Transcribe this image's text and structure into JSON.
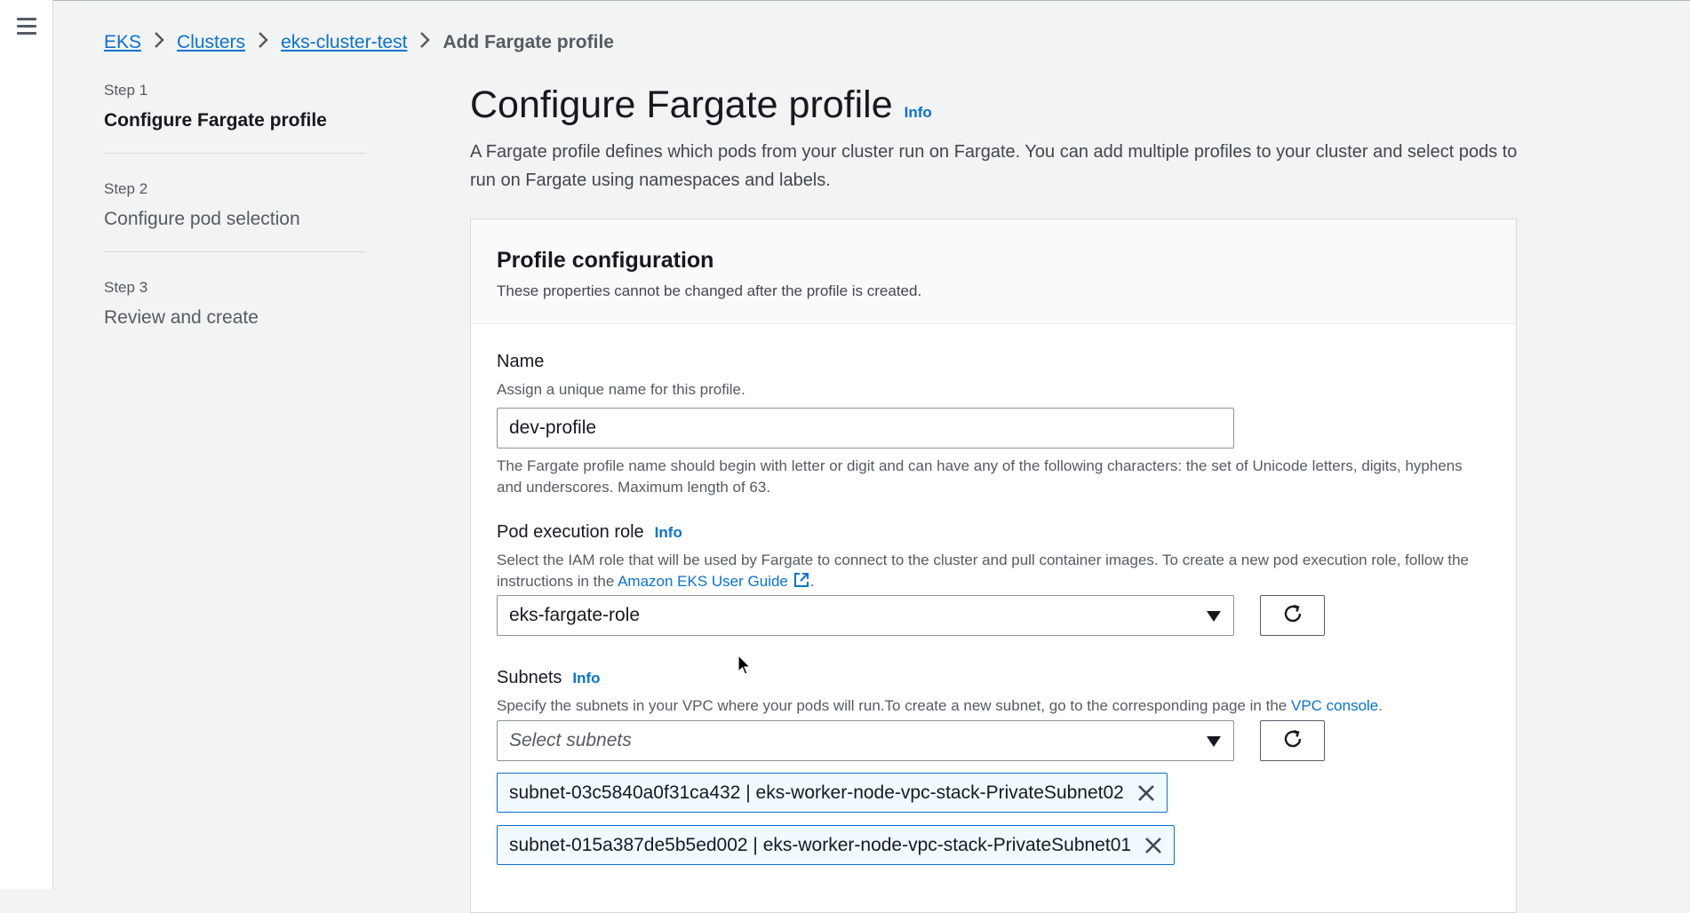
{
  "breadcrumb": {
    "items": [
      "EKS",
      "Clusters",
      "eks-cluster-test"
    ],
    "current": "Add Fargate profile"
  },
  "steps": [
    {
      "num": "Step 1",
      "title": "Configure Fargate profile",
      "active": true
    },
    {
      "num": "Step 2",
      "title": "Configure pod selection",
      "active": false
    },
    {
      "num": "Step 3",
      "title": "Review and create",
      "active": false
    }
  ],
  "page": {
    "title": "Configure Fargate profile",
    "info": "Info",
    "description": "A Fargate profile defines which pods from your cluster run on Fargate. You can add multiple profiles to your cluster and select pods to run on Fargate using namespaces and labels."
  },
  "card": {
    "title": "Profile configuration",
    "subtitle": "These properties cannot be changed after the profile is created."
  },
  "name_field": {
    "label": "Name",
    "help": "Assign a unique name for this profile.",
    "value": "dev-profile",
    "constraint": "The Fargate profile name should begin with letter or digit and can have any of the following characters: the set of Unicode letters, digits, hyphens and underscores. Maximum length of 63."
  },
  "role_field": {
    "label": "Pod execution role",
    "info": "Info",
    "help_prefix": "Select the IAM role that will be used by Fargate to connect to the cluster and pull container images. To create a new pod execution role, follow the instructions in the ",
    "help_link": "Amazon EKS User Guide",
    "help_suffix": ".",
    "value": "eks-fargate-role"
  },
  "subnets_field": {
    "label": "Subnets",
    "info": "Info",
    "help_prefix": "Specify the subnets in your VPC where your pods will run.To create a new subnet, go to the corresponding page in the ",
    "help_link": "VPC console",
    "help_suffix": ".",
    "placeholder": "Select subnets",
    "tokens": [
      "subnet-03c5840a0f31ca432 | eks-worker-node-vpc-stack-PrivateSubnet02",
      "subnet-015a387de5b5ed002 | eks-worker-node-vpc-stack-PrivateSubnet01"
    ]
  },
  "icons": {
    "menu": "hamburger-menu-icon",
    "breadcrumb_separator": "chevron-right-icon",
    "external": "external-link-icon",
    "refresh": "refresh-icon",
    "dismiss": "close-icon",
    "dropdown": "caret-down-icon",
    "pointer": "mouse-cursor-icon"
  },
  "colors": {
    "link": "#0972d3",
    "token_border": "#0972d3",
    "token_bg": "#f1faff",
    "page_bg": "#f2f3f3"
  }
}
